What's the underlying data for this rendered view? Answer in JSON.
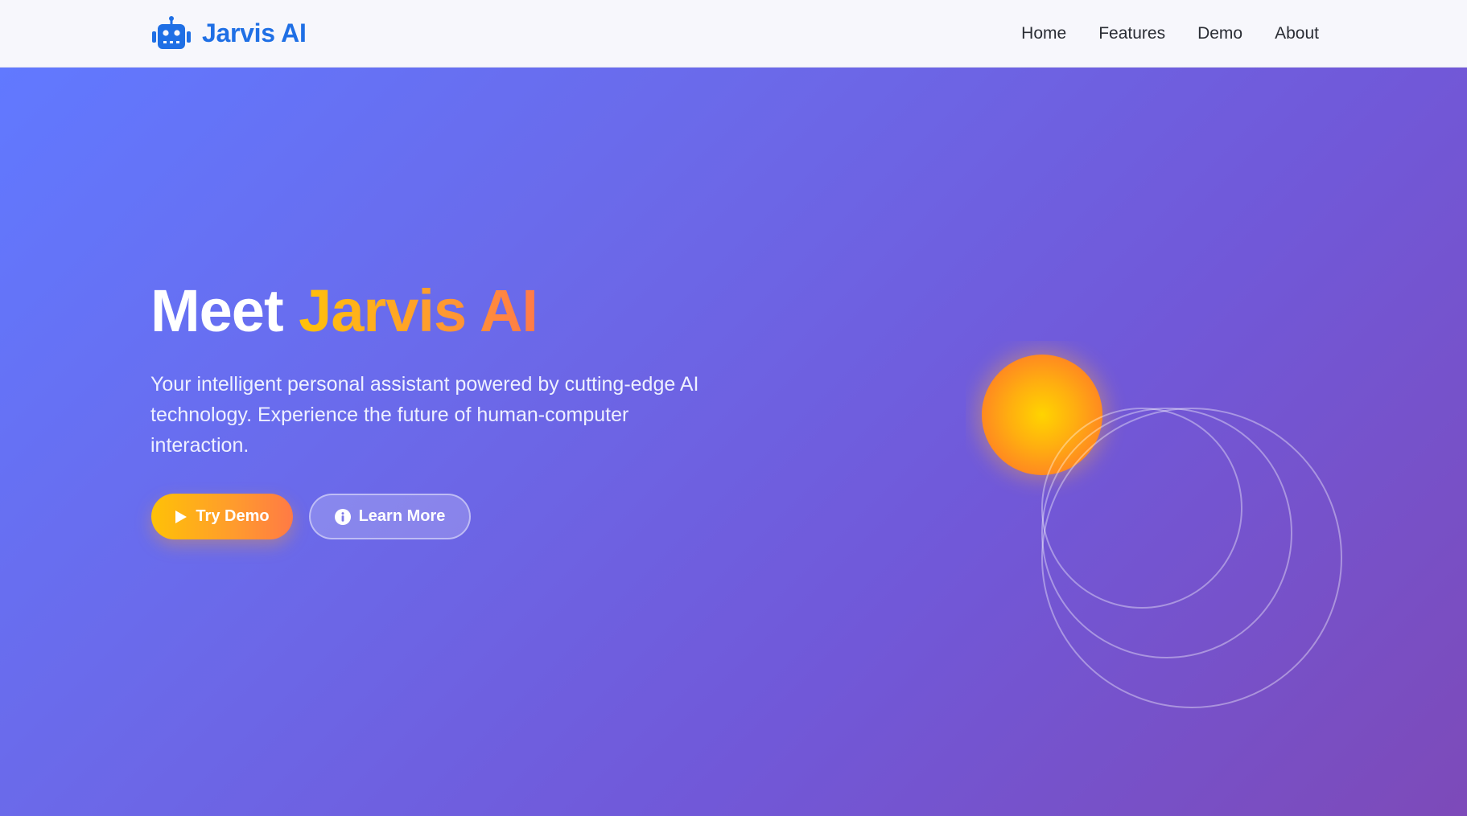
{
  "navbar": {
    "brand_name": "Jarvis AI",
    "brand_icon": "robot-icon",
    "brand_color": "#1f6fe5",
    "links": [
      {
        "label": "Home"
      },
      {
        "label": "Features"
      },
      {
        "label": "Demo"
      },
      {
        "label": "About"
      }
    ]
  },
  "hero": {
    "title_prefix": "Meet",
    "title_highlight": "Jarvis AI",
    "subtitle": "Your intelligent personal assistant powered by cutting-edge AI technology. Experience the future of human-computer interaction.",
    "primary_button": {
      "label": "Try Demo",
      "icon": "play-icon"
    },
    "secondary_button": {
      "label": "Learn More",
      "icon": "info-icon"
    },
    "colors": {
      "gradient_start": "#6179ff",
      "gradient_end": "#7d4ab9",
      "accent_yellow": "#ffc107",
      "accent_orange": "#ff7a45"
    }
  }
}
